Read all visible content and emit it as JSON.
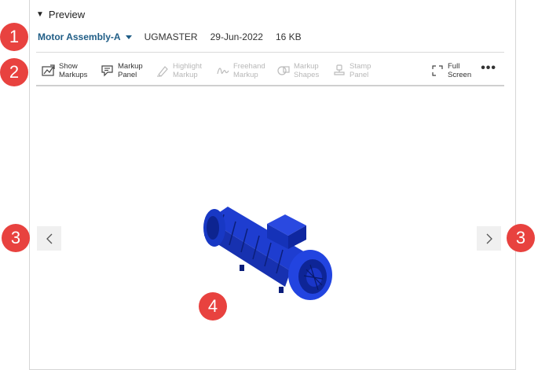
{
  "preview": {
    "title": "Preview",
    "toggle_icon": "collapse-triangle-icon"
  },
  "meta": {
    "item_name": "Motor Assembly-A",
    "item_dropdown_icon": "chevron-down-icon",
    "dataset_type": "UGMASTER",
    "date": "29-Jun-2022",
    "size": "16 KB"
  },
  "toolbar": {
    "buttons": [
      {
        "label": "Show\nMarkups",
        "icon": "show-markups-icon",
        "enabled": true
      },
      {
        "label": "Markup\nPanel",
        "icon": "markup-panel-icon",
        "enabled": true
      },
      {
        "label": "Highlight\nMarkup",
        "icon": "highlight-markup-icon",
        "enabled": false
      },
      {
        "label": "Freehand\nMarkup",
        "icon": "freehand-markup-icon",
        "enabled": false
      },
      {
        "label": "Markup\nShapes",
        "icon": "markup-shapes-icon",
        "enabled": false
      },
      {
        "label": "Stamp\nPanel",
        "icon": "stamp-panel-icon",
        "enabled": false
      },
      {
        "label": "Full\nScreen",
        "icon": "full-screen-icon",
        "enabled": true
      }
    ],
    "more_label": "•••"
  },
  "viewer": {
    "image": "motor-assembly-3d-model",
    "prev_icon": "chevron-left-icon",
    "next_icon": "chevron-right-icon",
    "model_color": "#1f3fd6"
  },
  "callouts": [
    "1",
    "2",
    "3",
    "3",
    "4"
  ],
  "colors": {
    "accent": "#1f5d86",
    "callout": "#e8423f",
    "disabled": "#b8b8b8"
  }
}
